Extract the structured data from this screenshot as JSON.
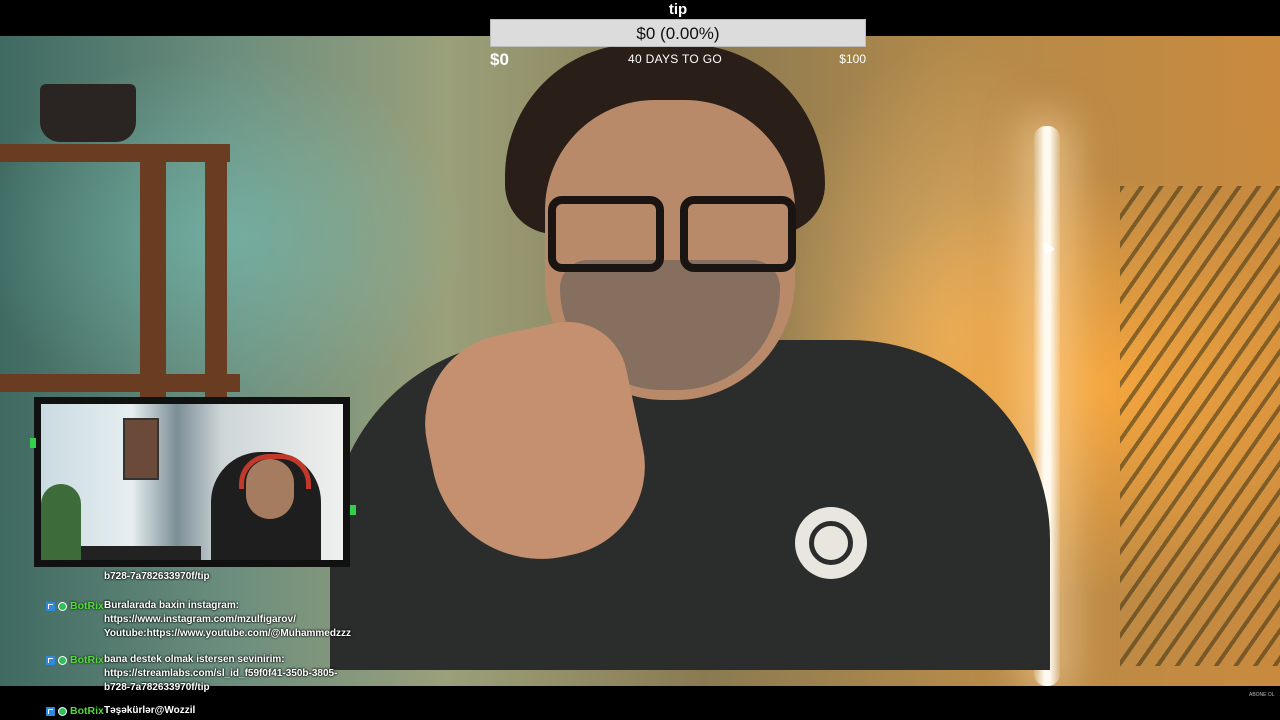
{
  "goal": {
    "title": "tip",
    "progress_text": "$0 (0.00%)",
    "progress_fraction": 0,
    "min_label": "$0",
    "days_label": "40 DAYS TO GO",
    "max_label": "$100",
    "fill_color": "#7bd86c"
  },
  "chat": {
    "username_color": "#55d93b",
    "messages": [
      {
        "user": "",
        "lines": [
          "b728-7a782633970f/tip"
        ]
      },
      {
        "user": "BotRix",
        "lines": [
          "Buralarada baxin instagram:",
          "https://www.instagram.com/mzulfigarov/",
          "Youtube:https://www.youtube.com/@Muhammedzzz"
        ]
      },
      {
        "user": "BotRix",
        "lines": [
          "bana destek olmak istersen sevinirim:",
          "https://streamlabs.com/sl_id_f59f0f41-350b-3805-",
          "b728-7a782633970f/tip"
        ]
      },
      {
        "user": "BotRix",
        "lines": [
          "Təşəkürlər@Wozzil"
        ]
      }
    ]
  },
  "watermark": "ABONE OL"
}
